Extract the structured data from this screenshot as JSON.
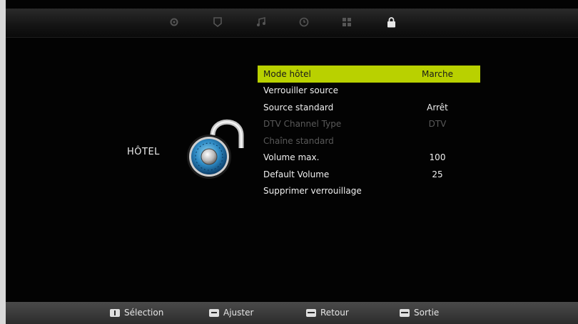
{
  "tabs": [
    {
      "name": "picture-tab-icon",
      "active": false
    },
    {
      "name": "sound-tab-icon",
      "active": false
    },
    {
      "name": "music-tab-icon",
      "active": false
    },
    {
      "name": "clock-tab-icon",
      "active": false
    },
    {
      "name": "setup-tab-icon",
      "active": false
    },
    {
      "name": "lock-tab-icon",
      "active": true
    }
  ],
  "section": {
    "title": "HÔTEL",
    "icon": "padlock-icon"
  },
  "menu": {
    "items": [
      {
        "label": "Mode hôtel",
        "value": "Marche",
        "state": "selected"
      },
      {
        "label": "Verrouiller source",
        "value": "",
        "state": "normal"
      },
      {
        "label": "Source standard",
        "value": "Arrêt",
        "state": "normal"
      },
      {
        "label": "DTV Channel Type",
        "value": "DTV",
        "state": "disabled"
      },
      {
        "label": "Chaîne standard",
        "value": "",
        "state": "disabled"
      },
      {
        "label": "Volume max.",
        "value": "100",
        "state": "normal"
      },
      {
        "label": "Default Volume",
        "value": "25",
        "state": "normal"
      },
      {
        "label": "Supprimer verrouillage",
        "value": "",
        "state": "normal"
      }
    ]
  },
  "hints": {
    "select": "Sélection",
    "adjust": "Ajuster",
    "back": "Retour",
    "exit": "Sortie"
  },
  "colors": {
    "highlight": "#b9d100",
    "background": "#030303",
    "disabled_text": "#595959"
  }
}
